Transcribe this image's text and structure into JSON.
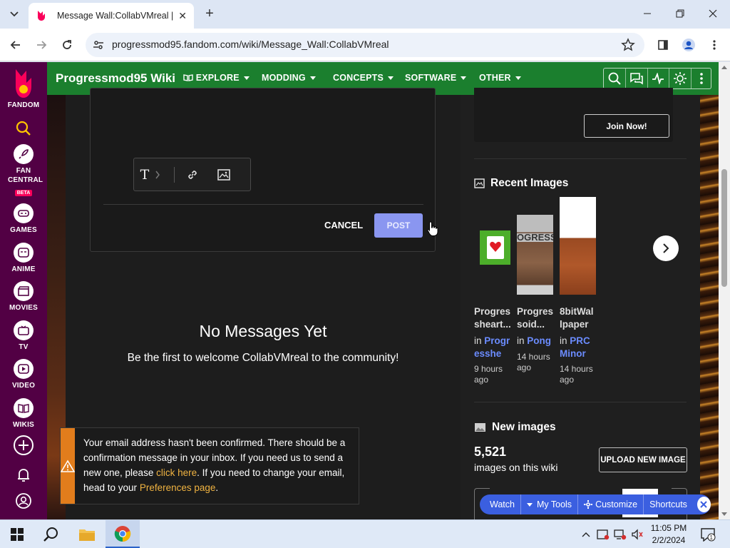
{
  "browser": {
    "tab_title": "Message Wall:CollabVMreal | P",
    "url": "progressmod95.fandom.com/wiki/Message_Wall:CollabVMreal"
  },
  "rail": {
    "items": [
      {
        "label": "FANDOM"
      },
      {
        "label": "FAN CENTRAL",
        "badge": "BETA"
      },
      {
        "label": "GAMES"
      },
      {
        "label": "ANIME"
      },
      {
        "label": "MOVIES"
      },
      {
        "label": "TV"
      },
      {
        "label": "VIDEO"
      },
      {
        "label": "WIKIS"
      }
    ]
  },
  "header": {
    "wiki_name": "Progressmod95 Wiki",
    "nav": [
      "EXPLORE",
      "MODDING",
      "CONCEPTS",
      "SOFTWARE",
      "OTHER"
    ]
  },
  "editor": {
    "text_format_glyph": "T",
    "cancel_label": "CANCEL",
    "post_label": "POST"
  },
  "empty_state": {
    "title": "No Messages Yet",
    "subtitle": "Be the first to welcome CollabVMreal to the community!"
  },
  "notice": {
    "text_1": "Your email address hasn't been confirmed. There should be a confirmation message in your inbox. If you need us to send a new one, please ",
    "link_1": "click here",
    "text_2": ". If you need to change your email, head to your ",
    "link_2": "Preferences page",
    "text_3": "."
  },
  "right_rail": {
    "join_label": "Join Now!",
    "recent_images_title": "Recent Images",
    "recent_images": [
      {
        "name_line1": "Progres",
        "name_line2": "sheart...",
        "in_label": "in",
        "category_line1": "Progr",
        "category_line2": "esshe",
        "time_line1": "9 hours",
        "time_line2": "ago"
      },
      {
        "name_line1": "Progres",
        "name_line2": "soid...",
        "in_label": "in",
        "category_line1": "Pong",
        "category_line2": "",
        "time_line1": "14 hours",
        "time_line2": "ago"
      },
      {
        "name_line1": "8bitWal",
        "name_line2": "lpaper",
        "in_label": "in",
        "category_line1": "PRC",
        "category_line2": "Minor",
        "time_line1": "14 hours",
        "time_line2": "ago"
      }
    ],
    "thumb_banner_text": "OGRESS",
    "new_images_title": "New images",
    "images_count": "5,521",
    "images_count_label": "images on this wiki",
    "upload_label": "UPLOAD NEW IMAGE"
  },
  "floating_toolbar": {
    "items": [
      "Watch",
      "My Tools",
      "Customize",
      "Shortcuts"
    ]
  },
  "taskbar": {
    "time": "11:05 PM",
    "date": "2/2/2024"
  },
  "colors": {
    "rail": "#520044",
    "wiki_header": "#1b7f2e",
    "post_button": "#8a96f0",
    "notice_warning": "#e27d1c",
    "link": "#6b8cff",
    "toolbar_blue": "#3b5fe0"
  }
}
